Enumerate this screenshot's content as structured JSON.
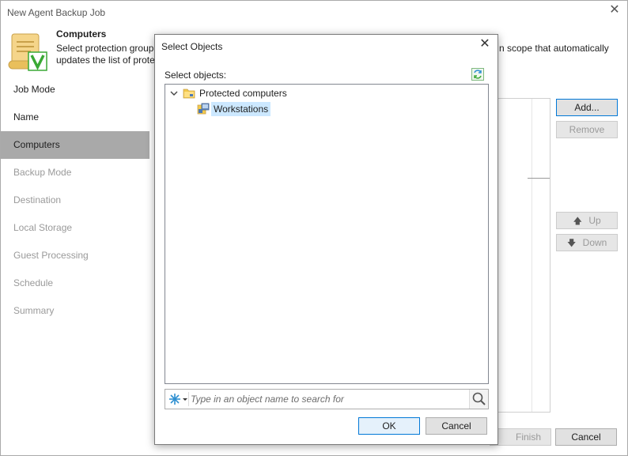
{
  "window": {
    "title": "New Agent Backup Job"
  },
  "header": {
    "title": "Computers",
    "description_line1": "Select protection group",
    "description_line1_right": "n scope that automatically",
    "description_line2": "updates the list of prote"
  },
  "nav": {
    "items": [
      {
        "label": "Job Mode",
        "state": "done"
      },
      {
        "label": "Name",
        "state": "done"
      },
      {
        "label": "Computers",
        "state": "active"
      },
      {
        "label": "Backup Mode",
        "state": "pending"
      },
      {
        "label": "Destination",
        "state": "pending"
      },
      {
        "label": "Local Storage",
        "state": "pending"
      },
      {
        "label": "Guest Processing",
        "state": "pending"
      },
      {
        "label": "Schedule",
        "state": "pending"
      },
      {
        "label": "Summary",
        "state": "pending"
      }
    ]
  },
  "side_buttons": {
    "add": "Add...",
    "remove": "Remove",
    "up": "Up",
    "down": "Down"
  },
  "footer": {
    "finish": "Finish",
    "cancel": "Cancel"
  },
  "dialog": {
    "title": "Select Objects",
    "label": "Select objects:",
    "tree": {
      "root": {
        "label": "Protected computers",
        "expanded": true,
        "icon": "folder-icon"
      },
      "children": [
        {
          "label": "Workstations",
          "selected": true,
          "icon": "protection-group-icon"
        }
      ]
    },
    "search": {
      "placeholder": "Type in an object name to search for",
      "value": ""
    },
    "ok": "OK",
    "cancel": "Cancel"
  },
  "colors": {
    "accent": "#0078d7",
    "active_nav": "#a9a9a9",
    "selected_row": "#cce8ff",
    "brand_icon_green": "#3aa935"
  }
}
